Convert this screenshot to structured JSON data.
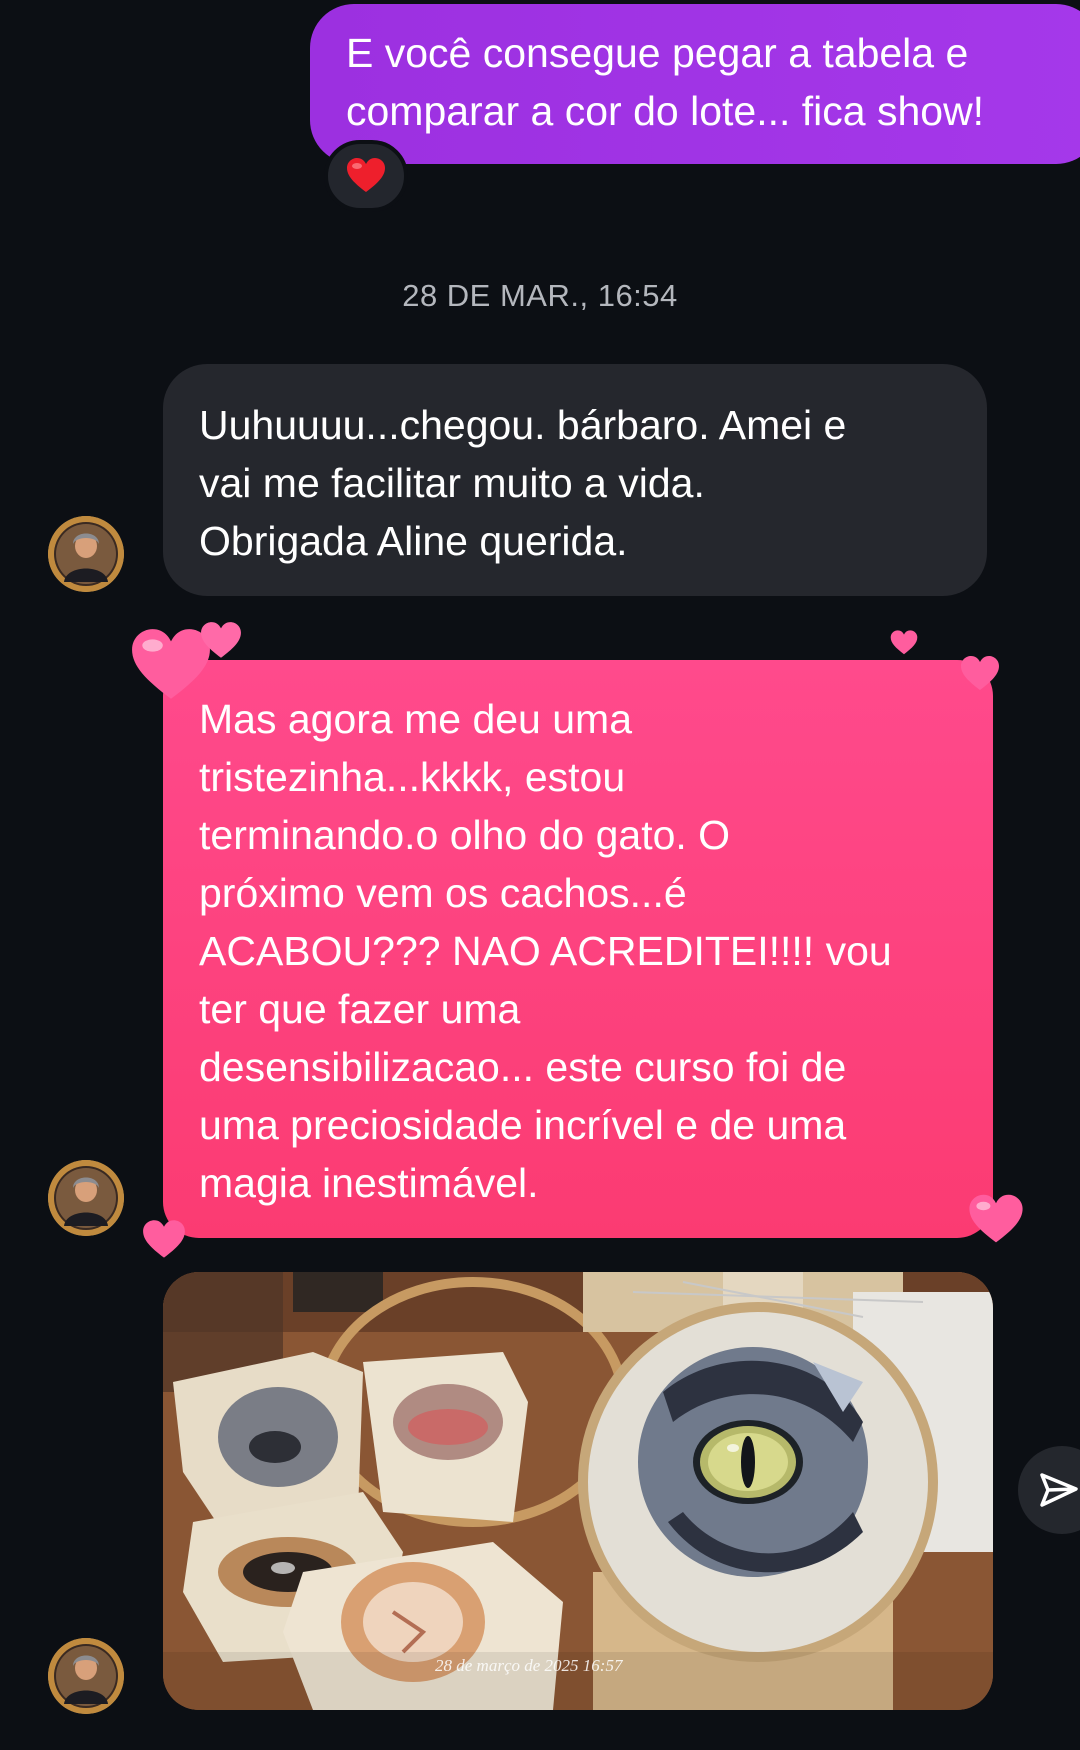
{
  "conversation": {
    "sent_message": {
      "lines": [
        "E você consegue pegar a tabela e",
        "comparar a cor do lote... fica show!"
      ],
      "reaction": "❤️"
    },
    "timestamp": "28 DE MAR., 16:54",
    "received_messages": [
      {
        "lines": [
          "Uuhuuuu...chegou. bárbaro. Amei e",
          "vai me facilitar muito a vida.",
          "Obrigada Aline querida."
        ]
      },
      {
        "effect": "hearts",
        "lines": [
          "Mas agora me deu uma",
          "tristezinha...kkkk, estou",
          "terminando.o olho do gato. O",
          "próximo vem os cachos...é",
          "ACABOU??? NAO ACREDITEI!!!! vou",
          "ter que fazer uma",
          "desensibilizacao... este curso foi de",
          "uma preciosidade incrível e de uma",
          "magia inestimável."
        ]
      }
    ],
    "photo": {
      "caption": "28 de março de 2025 16:57"
    }
  },
  "colors": {
    "background": "#0c0f14",
    "sent_bubble": "#a034e6",
    "received_bubble": "#25272d",
    "effect_bubble": "#fb4680",
    "timestamp_text": "#b4b7bd"
  },
  "icons": {
    "reaction": "red-heart-emoji",
    "share": "paper-plane-icon",
    "avatar": "user-avatar"
  }
}
